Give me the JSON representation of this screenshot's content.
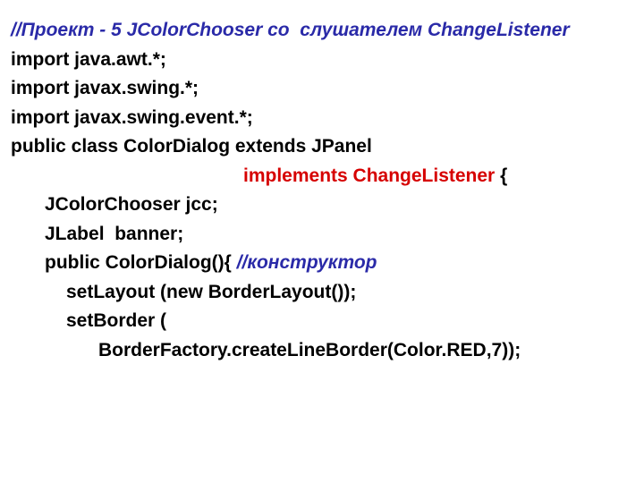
{
  "lines": {
    "l1": "//Проект - 5 JColorChooser со  слушателем ChangeListener",
    "l2": "import java.awt.*;",
    "l3": "import javax.swing.*;",
    "l4": "import javax.swing.event.*;",
    "l5": "public class ColorDialog extends JPanel",
    "l6a": "implements ChangeListener",
    "l6b": " {",
    "l7": "JColorChooser jcc;",
    "l8": "JLabel  banner;",
    "l9a": "public ColorDialog(){ ",
    "l9b": "//конструктор",
    "l10": "setLayout (new BorderLayout());",
    "l11": "setBorder (",
    "l12": "BorderFactory.createLineBorder(Color.RED,7));"
  }
}
